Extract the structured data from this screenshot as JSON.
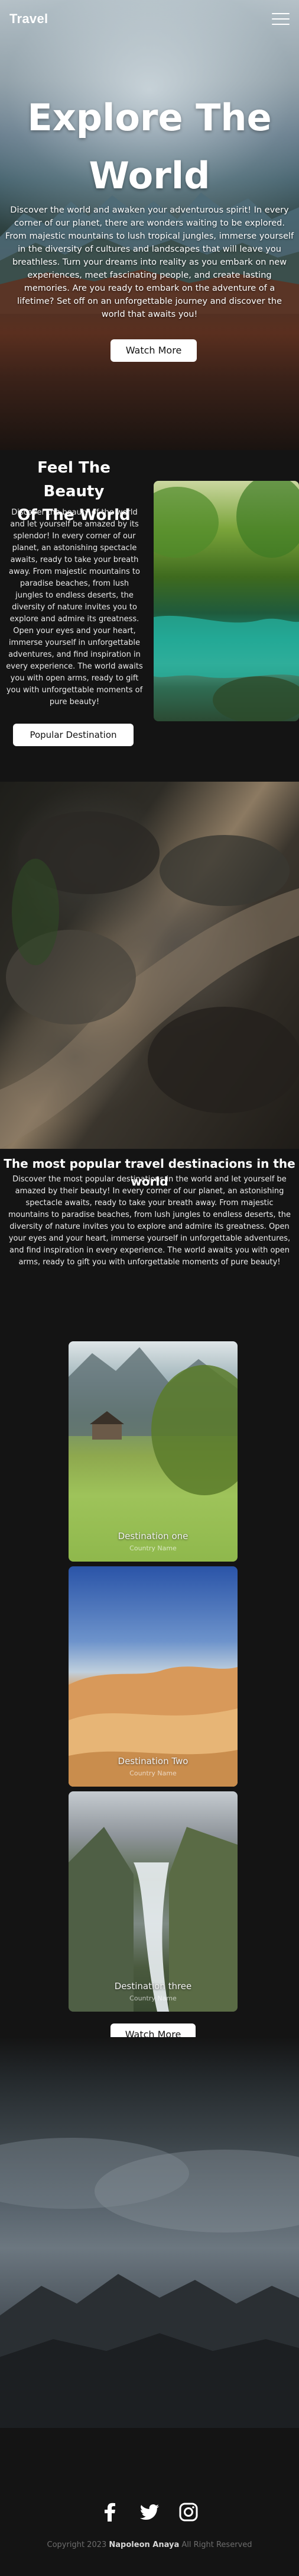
{
  "nav": {
    "brand": "Travel"
  },
  "hero": {
    "title_line1": "Explore The",
    "title_line2": "World",
    "description": "Discover the world and awaken your adventurous spirit! In every corner of our planet, there are wonders waiting to be explored. From majestic mountains to lush tropical jungles, immerse yourself in the diversity of cultures and landscapes that will leave you breathless. Turn your dreams into reality as you embark on new experiences, meet fascinating people, and create lasting memories. Are you ready to embark on the adventure of a lifetime? Set off on an unforgettable journey and discover the world that awaits you!",
    "button": "Watch More"
  },
  "feel": {
    "title_line1": "Feel The Beauty",
    "title_line2": "Of The World",
    "description": "Discover the beauty of the world and let yourself be amazed by its splendor! In every corner of our planet, an astonishing spectacle awaits, ready to take your breath away. From majestic mountains to paradise beaches, from lush jungles to endless deserts, the diversity of nature invites you to explore and admire its greatness. Open your eyes and your heart, immerse yourself in unforgettable adventures, and find inspiration in every experience. The world awaits you with open arms, ready to gift you with unforgettable moments of pure beauty!",
    "button": "Popular Destination"
  },
  "popular": {
    "title": "The most popular travel destinacions in the world",
    "description": "Discover the most popular destinations in the world and let yourself be amazed by their beauty! In every corner of our planet, an astonishing spectacle awaits, ready to take your breath away. From majestic mountains to paradise beaches, from lush jungles to endless deserts, the diversity of nature invites you to explore and admire its greatness. Open your eyes and your heart, immerse yourself in unforgettable adventures, and find inspiration in every experience. The world awaits you with open arms, ready to gift you with unforgettable moments of pure beauty!",
    "cards": [
      {
        "name": "Destination one",
        "country": "Country Name"
      },
      {
        "name": "Destination Two",
        "country": "Country Name"
      },
      {
        "name": "Destination three",
        "country": "Country Name"
      }
    ],
    "button": "Watch More"
  },
  "footer": {
    "social": [
      "facebook-icon",
      "twitter-icon",
      "instagram-icon"
    ],
    "copyright_prefix": "Copyright 2023",
    "author": "Napoleon Anaya",
    "rights": "All Right Reserved"
  }
}
